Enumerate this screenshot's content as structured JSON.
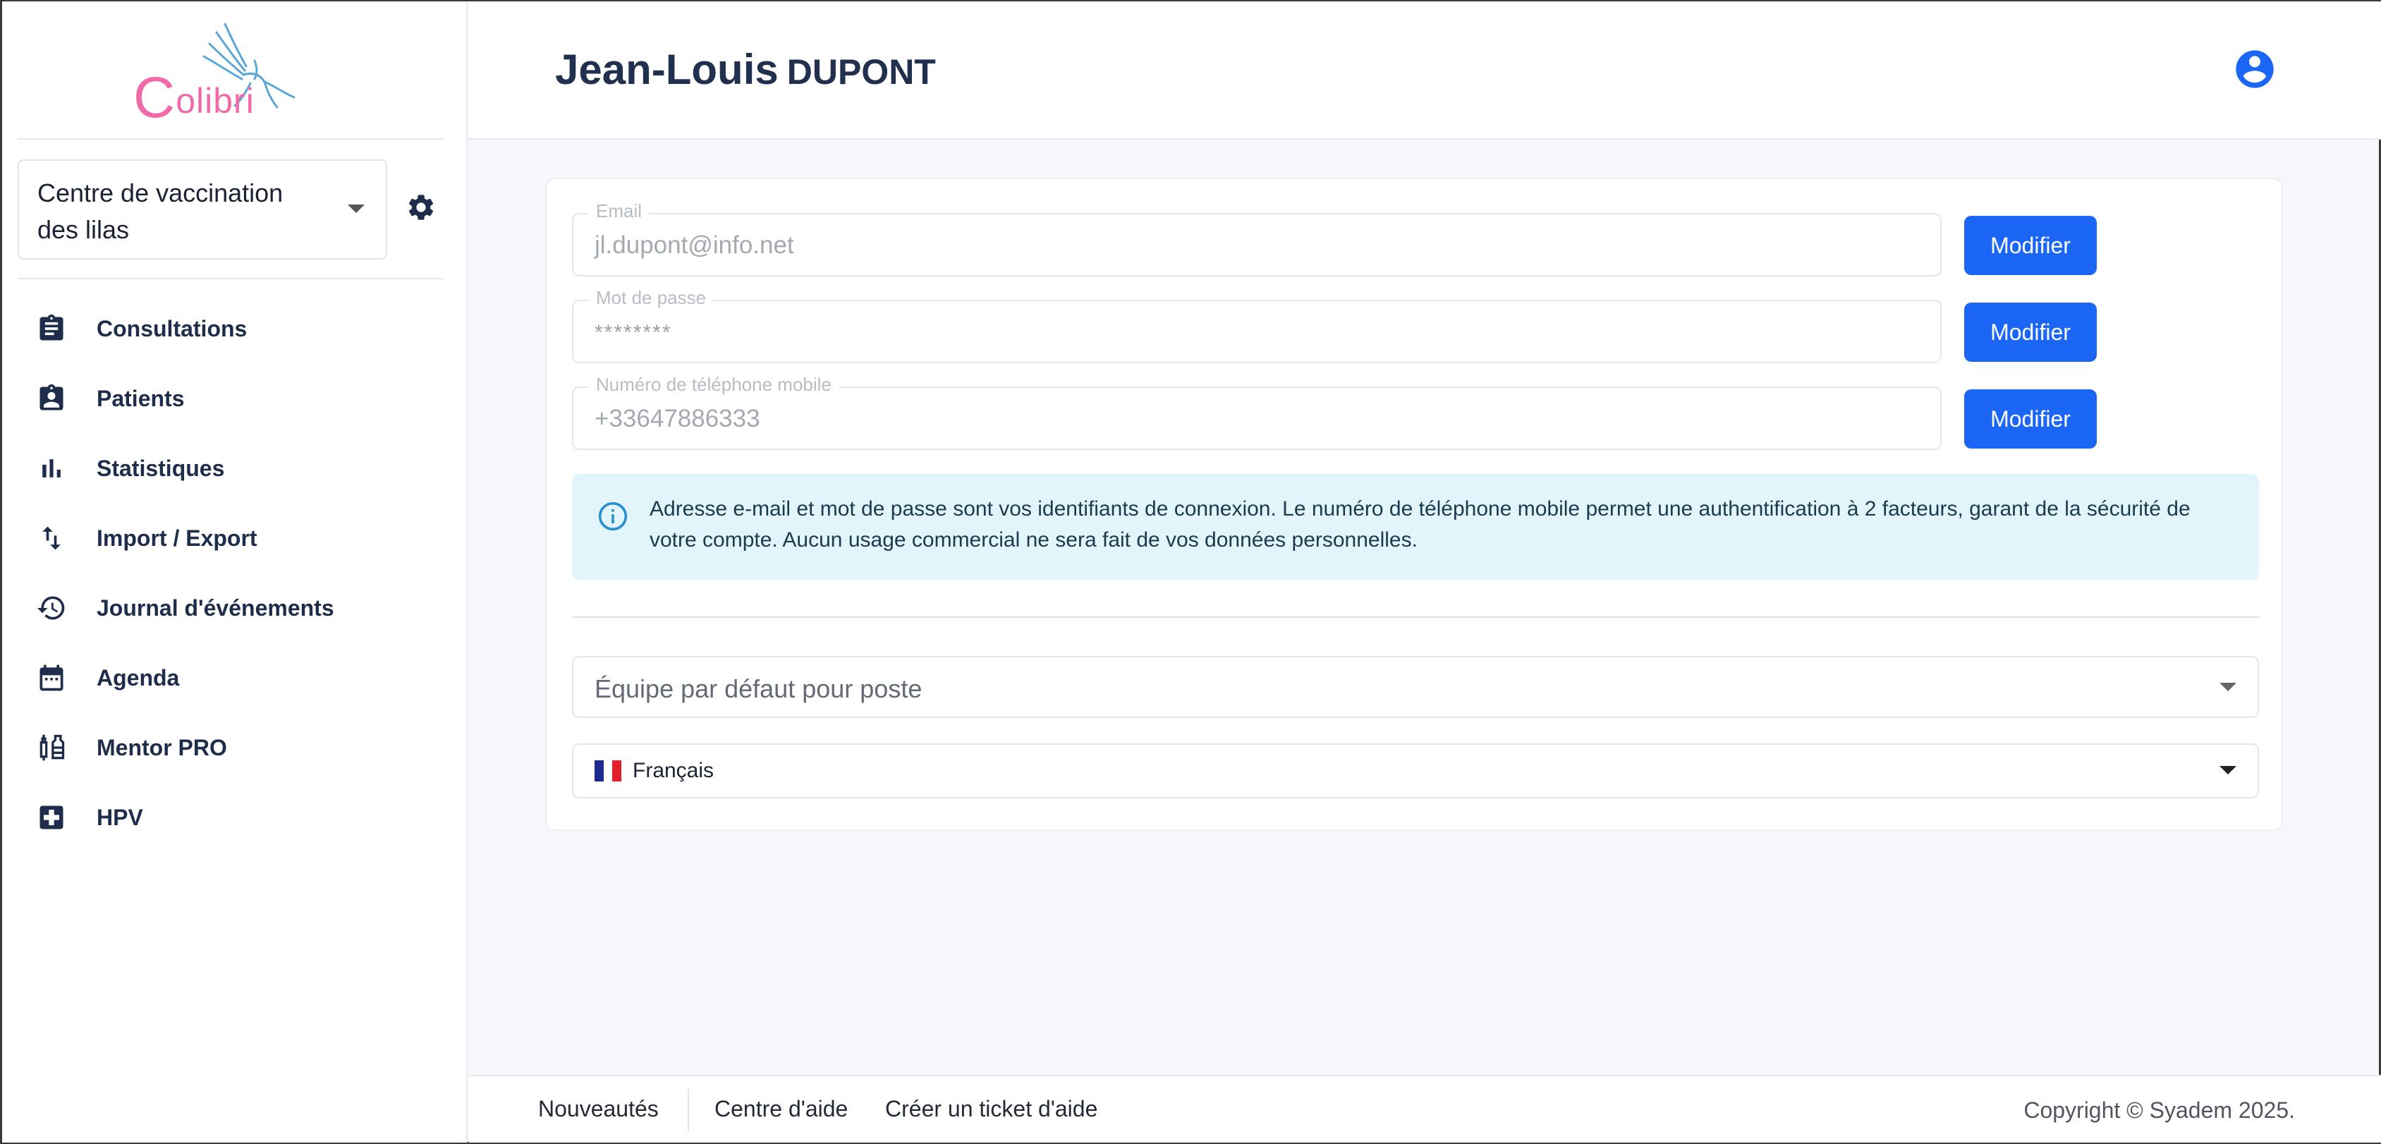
{
  "sidebar": {
    "logo": {
      "initial": "C",
      "rest": "olibri"
    },
    "center_select": {
      "value": "Centre de vaccination des lilas"
    },
    "nav": [
      {
        "id": "consultations",
        "label": "Consultations",
        "icon": "clipboard-icon"
      },
      {
        "id": "patients",
        "label": "Patients",
        "icon": "patient-badge-icon"
      },
      {
        "id": "statistiques",
        "label": "Statistiques",
        "icon": "bar-chart-icon"
      },
      {
        "id": "import-export",
        "label": "Import / Export",
        "icon": "import-export-arrows-icon"
      },
      {
        "id": "journal",
        "label": "Journal d'événements",
        "icon": "history-icon"
      },
      {
        "id": "agenda",
        "label": "Agenda",
        "icon": "calendar-icon"
      },
      {
        "id": "mentor-pro",
        "label": "Mentor PRO",
        "icon": "vaccine-icon"
      },
      {
        "id": "hpv",
        "label": "HPV",
        "icon": "medical-cross-icon"
      }
    ]
  },
  "header": {
    "first_name": "Jean-Louis",
    "last_name": "DUPONT"
  },
  "form": {
    "email": {
      "label": "Email",
      "value": "jl.dupont@info.net"
    },
    "password": {
      "label": "Mot de passe",
      "value": "********"
    },
    "phone": {
      "label": "Numéro de téléphone mobile",
      "value": "+33647886333"
    },
    "modify_label": "Modifier",
    "info": "Adresse e-mail et mot de passe sont vos identifiants de connexion. Le numéro de téléphone mobile permet une authentification à 2 facteurs, garant de la sécurité de votre compte. Aucun usage commercial ne sera fait de vos données personnelles.",
    "team_placeholder": "Équipe par défaut pour poste",
    "language": "Français"
  },
  "footer": {
    "links": [
      "Nouveautés",
      "Centre d'aide",
      "Créer un ticket d'aide"
    ],
    "copyright": "Copyright © Syadem 2025."
  },
  "colors": {
    "accent": "#1b66f5",
    "logo_pink": "#f06aa8",
    "logo_blue": "#5aa7d6",
    "info_bg": "#e1f5fb",
    "text_dark": "#1f2d4d"
  }
}
